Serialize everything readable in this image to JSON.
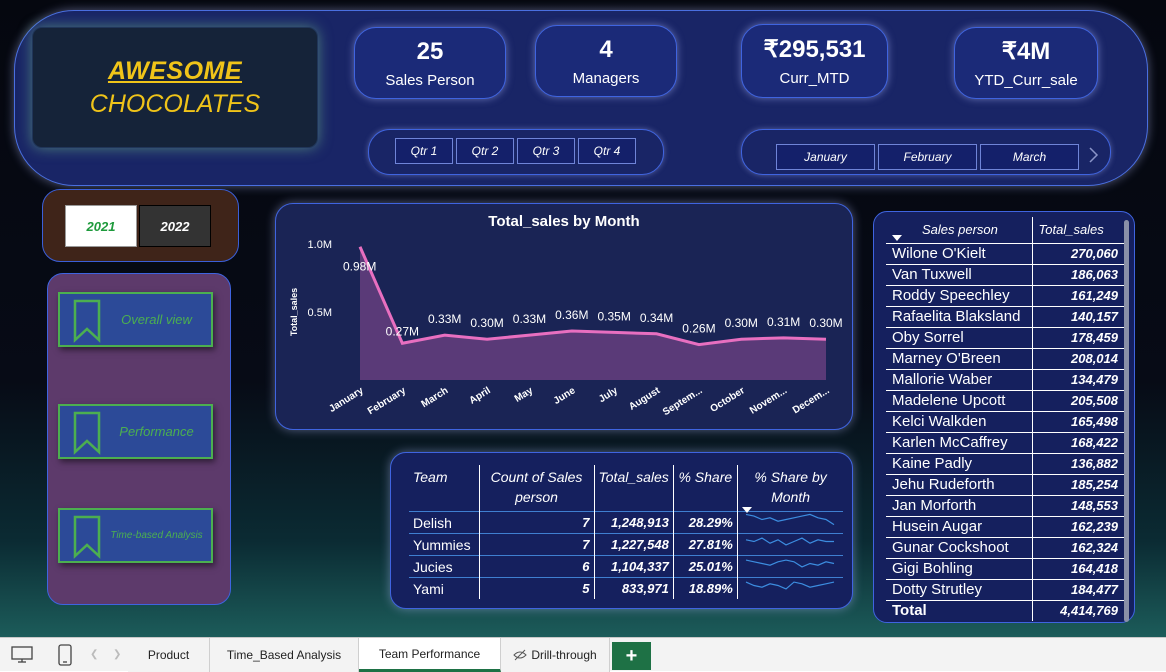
{
  "logo": {
    "line1": "AWESOME",
    "line2": "CHOCOLATES"
  },
  "kpis": [
    {
      "value": "25",
      "label": "Sales Person"
    },
    {
      "value": "4",
      "label": "Managers"
    },
    {
      "value": "₹295,531",
      "label": "Curr_MTD"
    },
    {
      "value": "₹4M",
      "label": "YTD_Curr_sale"
    }
  ],
  "quarters": [
    "Qtr 1",
    "Qtr 2",
    "Qtr 3",
    "Qtr 4"
  ],
  "months_slicer": [
    "January",
    "February",
    "March"
  ],
  "years": {
    "y2021": "2021",
    "y2022": "2022",
    "selected": "2021"
  },
  "nav": {
    "overall": "Overall view",
    "performance": "Performance",
    "time": "Time-based Analysis"
  },
  "chart_data": {
    "type": "area",
    "title": "Total_sales by Month",
    "ylabel": "Total_sales",
    "xlabel": "",
    "ylim": [
      0,
      1.0
    ],
    "y_ticks": [
      "1.0M",
      "0.5M"
    ],
    "categories": [
      "January",
      "February",
      "March",
      "April",
      "May",
      "June",
      "July",
      "August",
      "Septem...",
      "October",
      "Novem...",
      "Decem..."
    ],
    "values": [
      0.98,
      0.27,
      0.33,
      0.3,
      0.33,
      0.36,
      0.35,
      0.34,
      0.26,
      0.3,
      0.31,
      0.3
    ],
    "data_labels": [
      "0.98M",
      "0.27M",
      "0.33M",
      "0.30M",
      "0.33M",
      "0.36M",
      "0.35M",
      "0.34M",
      "0.26M",
      "0.30M",
      "0.31M",
      "0.30M"
    ],
    "colors": {
      "line": "#e86fc0",
      "fill": "#5a3a78"
    }
  },
  "team_table": {
    "headers": [
      "Team",
      "Count of Sales person",
      "Total_sales",
      "% Share",
      "% Share by Month"
    ],
    "rows": [
      {
        "team": "Delish",
        "count": "7",
        "total": "1,248,913",
        "share": "28.29%"
      },
      {
        "team": "Yummies",
        "count": "7",
        "total": "1,227,548",
        "share": "27.81%"
      },
      {
        "team": "Jucies",
        "count": "6",
        "total": "1,104,337",
        "share": "25.01%"
      },
      {
        "team": "Yami",
        "count": "5",
        "total": "833,971",
        "share": "18.89%"
      }
    ]
  },
  "sales_table": {
    "headers": [
      "Sales person",
      "Total_sales"
    ],
    "rows": [
      {
        "name": "Wilone O'Kielt",
        "value": "270,060"
      },
      {
        "name": "Van Tuxwell",
        "value": "186,063"
      },
      {
        "name": "Roddy Speechley",
        "value": "161,249"
      },
      {
        "name": "Rafaelita Blaksland",
        "value": "140,157"
      },
      {
        "name": "Oby Sorrel",
        "value": "178,459"
      },
      {
        "name": "Marney O'Breen",
        "value": "208,014"
      },
      {
        "name": "Mallorie Waber",
        "value": "134,479"
      },
      {
        "name": "Madelene Upcott",
        "value": "205,508"
      },
      {
        "name": "Kelci Walkden",
        "value": "165,498"
      },
      {
        "name": "Karlen McCaffrey",
        "value": "168,422"
      },
      {
        "name": "Kaine Padly",
        "value": "136,882"
      },
      {
        "name": "Jehu Rudeforth",
        "value": "185,254"
      },
      {
        "name": "Jan Morforth",
        "value": "148,553"
      },
      {
        "name": "Husein Augar",
        "value": "162,239"
      },
      {
        "name": "Gunar Cockshoot",
        "value": "162,324"
      },
      {
        "name": "Gigi Bohling",
        "value": "164,418"
      },
      {
        "name": "Dotty Strutley",
        "value": "184,477"
      }
    ],
    "total_label": "Total",
    "total_value": "4,414,769"
  },
  "tabs": [
    "Product",
    "Time_Based Analysis",
    "Team Performance",
    "Drill-through"
  ],
  "active_tab": "Team Performance",
  "colors": {
    "accent": "#4caf50",
    "gold": "#f0c419",
    "panel": "#15205e",
    "border": "#3f64e0",
    "tab_active": "#1e7145"
  }
}
